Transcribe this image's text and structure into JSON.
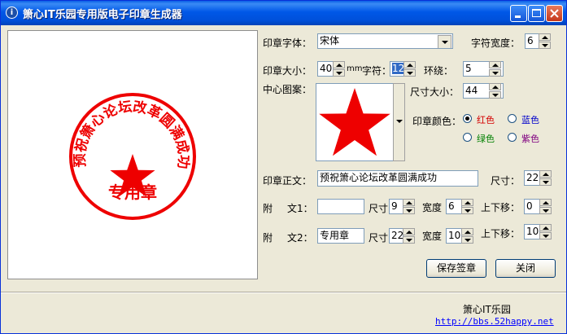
{
  "window": {
    "title": "箫心IT乐园专用版电子印章生成器"
  },
  "stamp": {
    "arc_text": "预祝箫心论坛改革圆满成功",
    "bottom_text": "专用章",
    "color": "#ee0000"
  },
  "form": {
    "font_label": "印章字体：",
    "font_value": "宋体",
    "char_width_label": "字符宽度：",
    "char_width_value": "6",
    "size_label": "印章大小：",
    "size_value": "40",
    "size_unit": "mm",
    "char_label": "字符：",
    "char_value": "12",
    "surround_label": "环绕：",
    "surround_value": "5",
    "center_pattern_label": "中心图案：",
    "pattern_size_label": "尺寸大小：",
    "pattern_size_value": "44",
    "color_label": "印章颜色：",
    "colors": {
      "red": "红色",
      "blue": "蓝色",
      "green": "绿色",
      "purple": "紫色"
    },
    "main_text_label": "印章正文：",
    "main_text_value": "预祝箫心论坛改革圆满成功",
    "main_size_label": "尺寸：",
    "main_size_value": "22",
    "attach1_label_a": "附",
    "attach1_label_b": "文1：",
    "attach1_value": "",
    "attach1_size_label": "尺寸",
    "attach1_size_value": "9",
    "attach1_width_label": "宽度",
    "attach1_width_value": "6",
    "attach1_shift_label": "上下移：",
    "attach1_shift_value": "0",
    "attach2_label_a": "附",
    "attach2_label_b": "文2：",
    "attach2_value": "专用章",
    "attach2_size_label": "尺寸",
    "attach2_size_value": "22",
    "attach2_width_label": "宽度",
    "attach2_width_value": "10",
    "attach2_shift_label": "上下移：",
    "attach2_shift_value": "10"
  },
  "buttons": {
    "save": "保存签章",
    "close": "关闭"
  },
  "footer": {
    "name": "箫心IT乐园",
    "url": "http://bbs.52happy.net"
  },
  "colors": {
    "red_label": "#d40000",
    "blue_label": "#0000cc",
    "green_label": "#008000",
    "purple_label": "#800080"
  }
}
